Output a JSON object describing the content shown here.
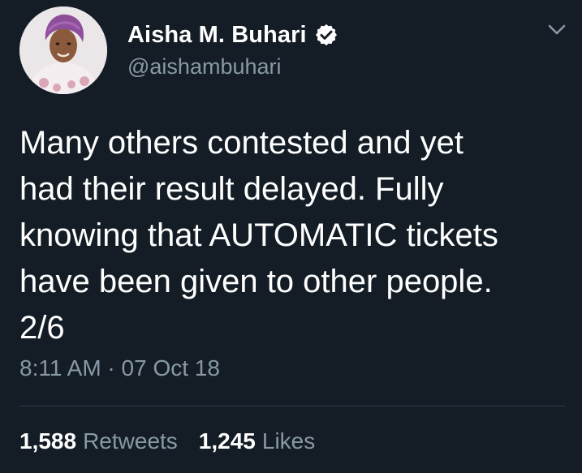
{
  "colors": {
    "background": "#141d26",
    "primary_text": "#ffffff",
    "secondary_text": "#8899a6",
    "divider": "#2b3a48",
    "verified_badge": "#ffffff"
  },
  "tweet": {
    "author": {
      "display_name": "Aisha M. Buhari",
      "handle": "@aishambuhari",
      "verified": true,
      "avatar_icon": "profile-photo"
    },
    "menu_icon": "chevron-down-icon",
    "text": "Many others contested and yet\nhad their result delayed. Fully\nknowing that AUTOMATIC tickets\nhave been given to other people.\n2/6",
    "timestamp": "8:11 AM · 07 Oct 18",
    "stats": {
      "retweets_count": "1,588",
      "retweets_label": "Retweets",
      "likes_count": "1,245",
      "likes_label": "Likes"
    }
  }
}
